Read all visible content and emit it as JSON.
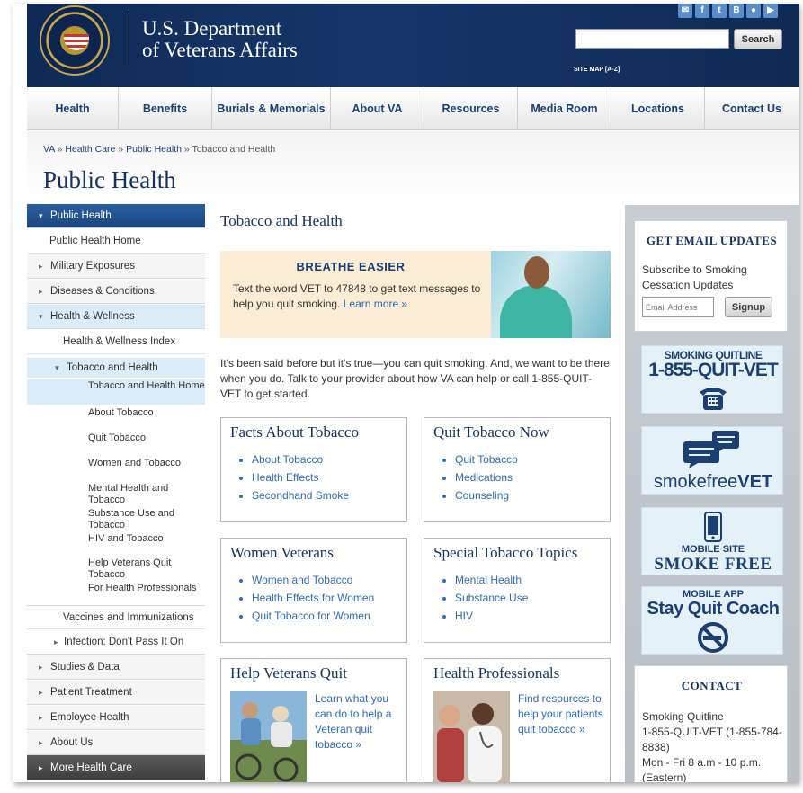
{
  "header": {
    "dept_line1": "U.S. Department",
    "dept_line2": "of Veterans Affairs",
    "search_placeholder": "",
    "search_button": "Search",
    "sitemap": "SITE MAP [A-Z]",
    "social_icons": [
      "email-icon",
      "facebook-icon",
      "twitter-icon",
      "blogger-icon",
      "flickr-icon",
      "youtube-icon"
    ],
    "social_glyphs": [
      "✉",
      "f",
      "t",
      "B",
      "●",
      "▶"
    ]
  },
  "nav": [
    "Health",
    "Benefits",
    "Burials & Memorials",
    "About VA",
    "Resources",
    "Media Room",
    "Locations",
    "Contact Us"
  ],
  "breadcrumb": {
    "items": [
      "VA",
      "Health Care",
      "Public Health"
    ],
    "sep": "»",
    "current": "Tobacco and Health"
  },
  "page_title": "Public Health",
  "leftnav": {
    "public_health": "Public Health",
    "public_health_home": "Public Health Home",
    "military_exposures": "Military Exposures",
    "diseases": "Diseases & Conditions",
    "health_wellness": "Health & Wellness",
    "health_wellness_index": "Health & Wellness Index",
    "tobacco_health": "Tobacco and Health",
    "sub": [
      "Tobacco and Health Home",
      "About Tobacco",
      "Quit Tobacco",
      "Women and Tobacco",
      "Mental Health and Tobacco",
      "Substance Use and Tobacco",
      "HIV and Tobacco",
      "Help Veterans Quit Tobacco",
      "For Health Professionals"
    ],
    "vaccines": "Vaccines and Immunizations",
    "infection": "Infection: Don't Pass It On",
    "studies": "Studies & Data",
    "patient": "Patient Treatment",
    "employee": "Employee Health",
    "about": "About Us",
    "more": "More Health Care"
  },
  "main": {
    "section_title": "Tobacco and Health",
    "promo_title": "BREATHE EASIER",
    "promo_text": "Text the word VET to 47848 to get text messages to help you quit smoking.",
    "promo_link": "Learn more »",
    "intro": "It's been said before but it's true—you can quit smoking. And, we want to be there when you do. Talk to your provider about how VA can help or call 1-855-QUIT-VET to get started.",
    "boxes": [
      {
        "title": "Facts About Tobacco",
        "links": [
          "About Tobacco",
          "Health Effects",
          "Secondhand Smoke"
        ]
      },
      {
        "title": "Quit Tobacco Now",
        "links": [
          "Quit Tobacco",
          "Medications",
          "Counseling"
        ]
      },
      {
        "title": "Women Veterans",
        "links": [
          "Women and Tobacco",
          "Health Effects for Women",
          "Quit Tobacco for Women"
        ]
      },
      {
        "title": "Special Tobacco Topics",
        "links": [
          "Mental Health",
          "Substance Use",
          "HIV"
        ]
      }
    ],
    "help_box": {
      "title": "Help Veterans Quit",
      "text": "Learn what you can do to help a Veteran quit tobacco »"
    },
    "pro_box": {
      "title": "Health Professionals",
      "text": "Find resources to help your patients quit tobacco »"
    }
  },
  "rail": {
    "email_title": "GET EMAIL UPDATES",
    "email_text": "Subscribe to Smoking Cessation Updates",
    "email_placeholder": "Email Address",
    "signup": "Signup",
    "quitline_top": "SMOKING QUITLINE",
    "quitline_number": "1-855-QUIT-VET",
    "smokefree_a": "smokefree",
    "smokefree_b": "VET",
    "mobile_site_top": "MOBILE SITE",
    "mobile_site_main": "SMOKE FREE",
    "mobile_app_top": "MOBILE APP",
    "mobile_app_main": "Stay Quit Coach",
    "contact_title": "CONTACT",
    "contact_lines": [
      "Smoking Quitline",
      "1-855-QUIT-VET (1-855-784-8838)",
      "Mon - Fri 8 a.m - 10 p.m. (Eastern)"
    ]
  },
  "colors": {
    "header_navy": "#16366a",
    "nav_text": "#1c3f73",
    "link": "#2f6ab0",
    "promo_bg": "#fbecd5",
    "rail_bg": "#c7cdd3",
    "selected_nav": "#1b467f"
  }
}
